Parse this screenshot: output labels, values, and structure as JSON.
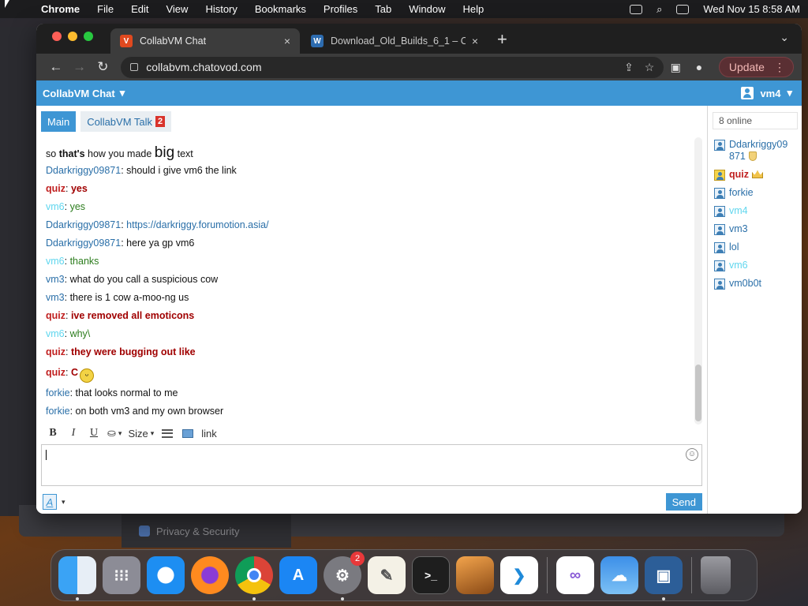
{
  "menubar": {
    "app_name": "Chrome",
    "items": [
      "File",
      "Edit",
      "View",
      "History",
      "Bookmarks",
      "Profiles",
      "Tab",
      "Window",
      "Help"
    ],
    "datetime": "Wed Nov 15  8:58 AM"
  },
  "browser": {
    "tabs": [
      {
        "title": "CollabVM Chat",
        "close": "×"
      },
      {
        "title": "Download_Old_Builds_6_1 – C",
        "close": "×"
      }
    ],
    "new_tab": "+",
    "url": "collabvm.chatovod.com",
    "update_label": "Update",
    "menu_glyph": "⋮"
  },
  "page": {
    "header_title": "CollabVM Chat",
    "current_user": "vm4",
    "chat_tabs": [
      {
        "label": "Main"
      },
      {
        "label": "CollabVM Talk",
        "badge": "2"
      }
    ],
    "messages": [
      {
        "parts": [
          "so ",
          "that's",
          " how you made ",
          "big",
          " text"
        ]
      },
      {
        "user": "Ddarkriggy09871",
        "text": "should i give vm6 the link"
      },
      {
        "user": "quiz",
        "text": "yes"
      },
      {
        "user": "vm6",
        "text": "yes"
      },
      {
        "user": "Ddarkriggy09871",
        "text": "https://darkriggy.forumotion.asia/"
      },
      {
        "user": "Ddarkriggy09871",
        "text": "here ya gp vm6"
      },
      {
        "user": "vm6",
        "text": "thanks"
      },
      {
        "user": "vm3",
        "text": "what do you call a suspicious cow"
      },
      {
        "user": "vm3",
        "text": "there is 1 cow a-moo-ng us"
      },
      {
        "user": "quiz",
        "text": "ive removed all emoticons"
      },
      {
        "user": "vm6",
        "text": "why\\"
      },
      {
        "user": "quiz",
        "text": "they were bugging out like"
      },
      {
        "user": "quiz",
        "text": "C"
      },
      {
        "user": "forkie",
        "text": "that looks normal to me"
      },
      {
        "user": "forkie",
        "text": "on both vm3 and my own browser"
      }
    ],
    "editor": {
      "bold": "B",
      "italic": "I",
      "underline": "U",
      "size_label": "Size",
      "link_label": "link",
      "font_glyph": "A",
      "send_label": "Send"
    },
    "online_count": "8 online",
    "users": [
      "Ddarkriggy09871",
      "quiz",
      "forkie",
      "vm4",
      "vm3",
      "lol",
      "vm6",
      "vm0b0t"
    ]
  },
  "background": {
    "privacy_label": "Privacy & Security"
  },
  "dock": {
    "apps": [
      "finder-icon",
      "launchpad-icon",
      "safari-icon",
      "firefox-icon",
      "chrome-icon",
      "app-store-icon",
      "system-settings-icon",
      "textedit-icon",
      "terminal-icon",
      "garageband-icon",
      "vscode-icon",
      "visual-studio-icon",
      "weather-icon",
      "virtualbox-icon",
      "trash-icon"
    ],
    "settings_badge": "2"
  },
  "colors": {
    "accent": "#3e96d4",
    "user_blue": "#2a6fa8",
    "user_cyan": "#5fd6ee",
    "user_red": "#c01f1f"
  }
}
